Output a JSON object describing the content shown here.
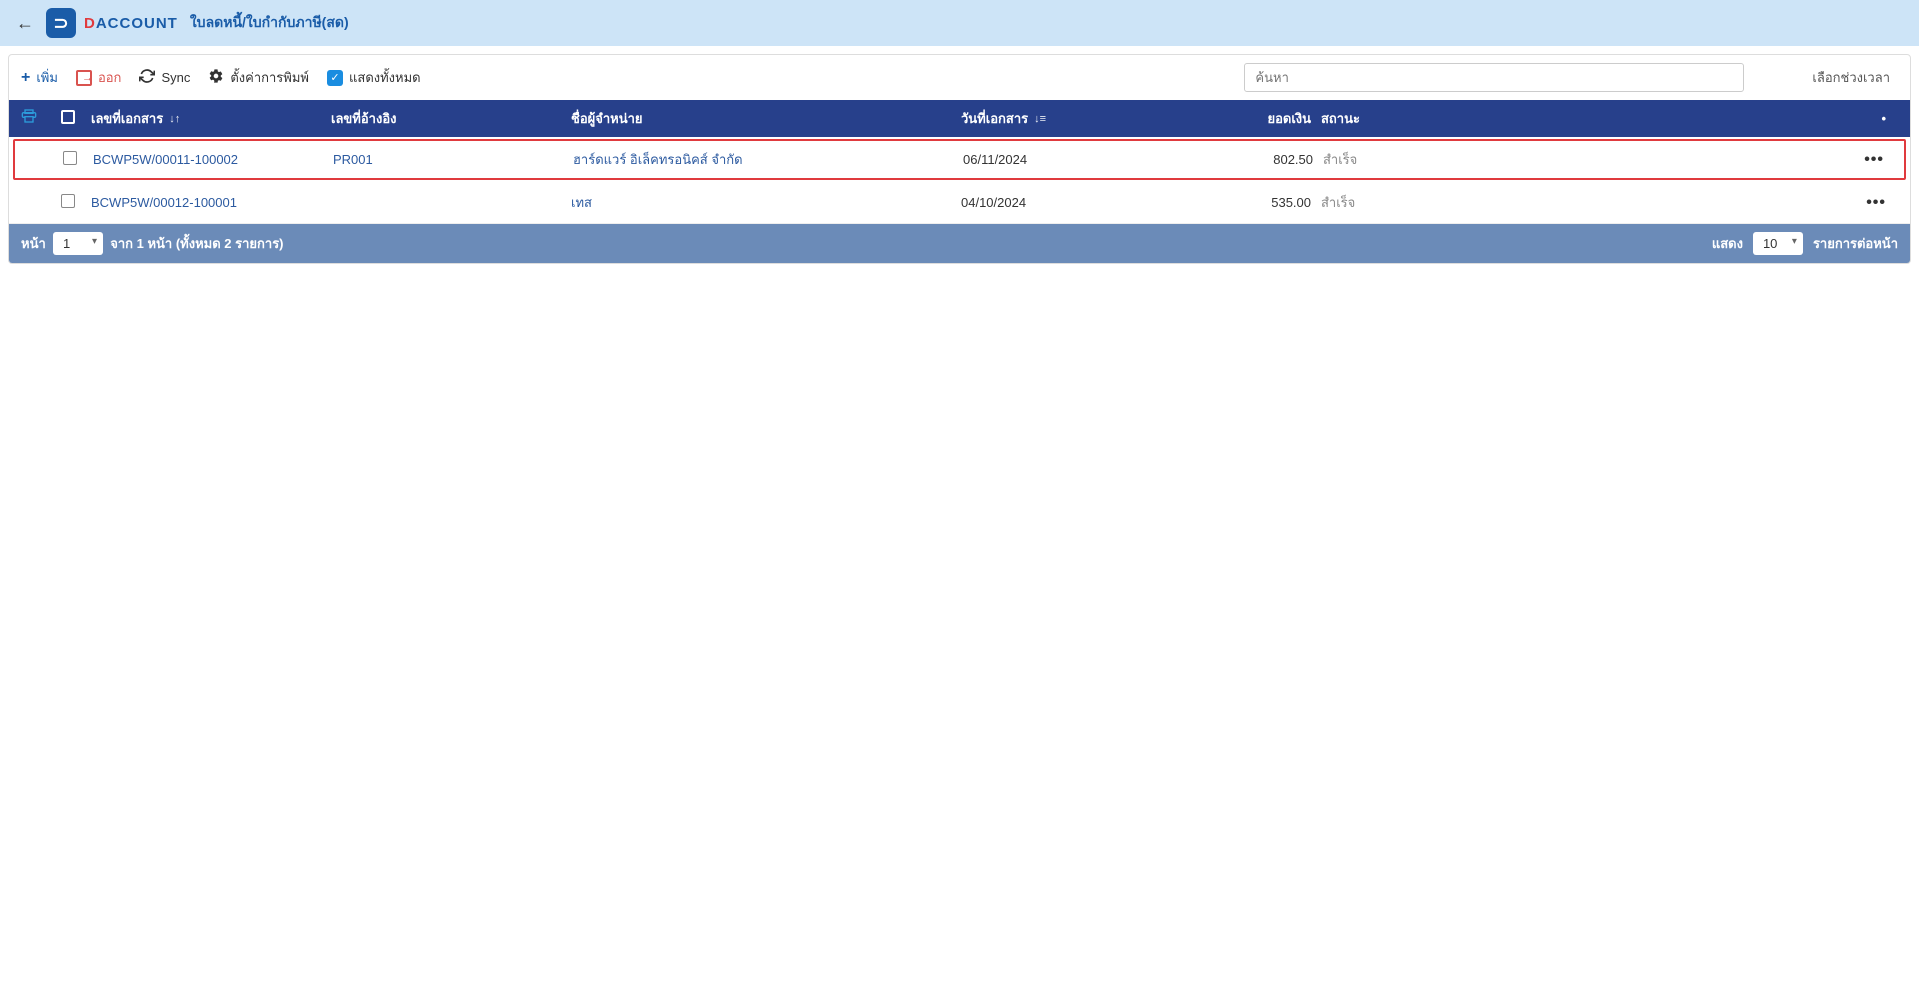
{
  "header": {
    "brand_d": "D",
    "brand_rest": "ACCOUNT",
    "title": "ใบลดหนี้/ใบกำกับภาษี(สด)"
  },
  "toolbar": {
    "add_label": "เพิ่ม",
    "exit_label": "ออก",
    "sync_label": "Sync",
    "print_settings_label": "ตั้งค่าการพิมพ์",
    "show_all_label": "แสดงทั้งหมด",
    "search_placeholder": "ค้นหา",
    "daterange_label": "เลือกช่วงเวลา"
  },
  "columns": {
    "docno": "เลขที่เอกสาร",
    "ref": "เลขที่อ้างอิง",
    "vendor": "ชื่อผู้จำหน่าย",
    "date": "วันที่เอกสาร",
    "amount": "ยอดเงิน",
    "status": "สถานะ",
    "more": "•"
  },
  "rows": [
    {
      "docno": "BCWP5W/00011-100002",
      "ref": "PR001",
      "vendor": "ฮาร์ดแวร์ อิเล็คทรอนิคส์ จำกัด",
      "date": "06/11/2024",
      "amount": "802.50",
      "status": "สำเร็จ",
      "highlighted": true
    },
    {
      "docno": "BCWP5W/00012-100001",
      "ref": "",
      "vendor": "เทส",
      "date": "04/10/2024",
      "amount": "535.00",
      "status": "สำเร็จ",
      "highlighted": false
    }
  ],
  "footer": {
    "page_label": "หน้า",
    "current_page": "1",
    "summary": "จาก 1 หน้า (ทั้งหมด 2 รายการ)",
    "show_label": "แสดง",
    "per_page": "10",
    "per_page_label": "รายการต่อหน้า"
  }
}
